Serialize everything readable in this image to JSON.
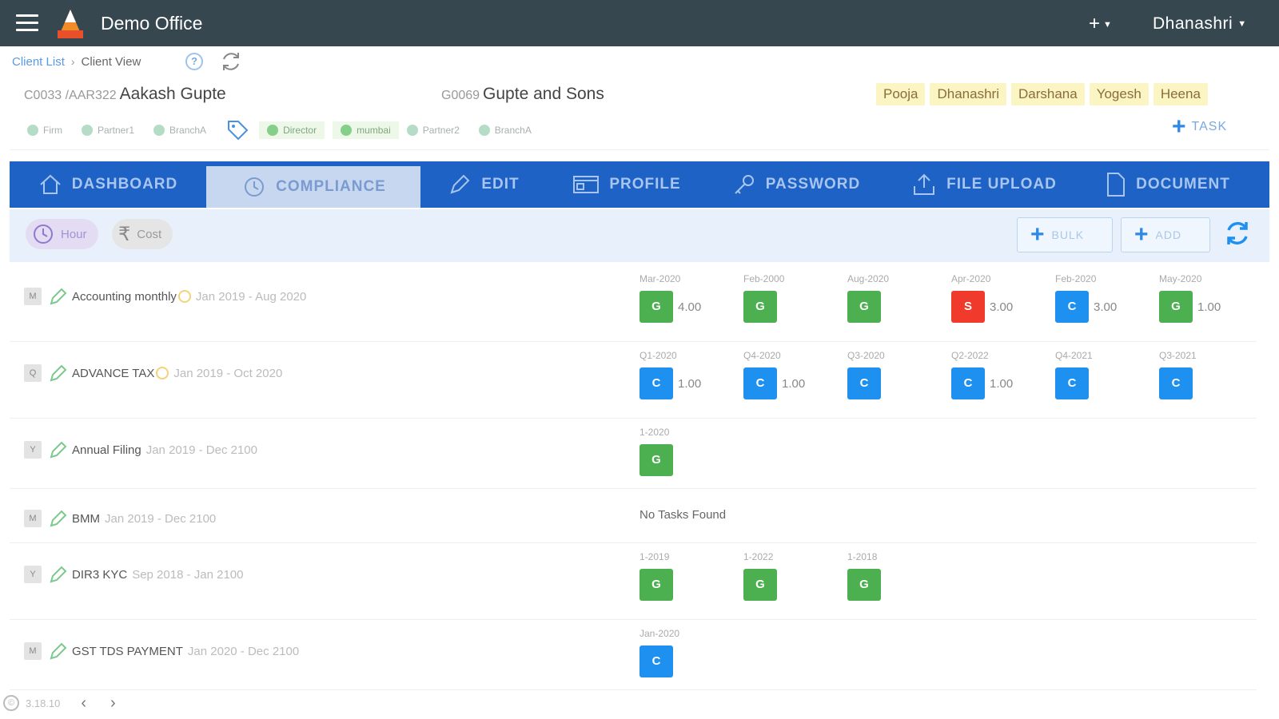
{
  "header": {
    "app_title": "Demo Office",
    "plus_label": "+",
    "user_name": "Dhanashri"
  },
  "breadcrumb": {
    "link": "Client List",
    "current": "Client View",
    "help": "?"
  },
  "client": {
    "code1": "C0033 /AAR322",
    "name1": "Aakash Gupte",
    "code2": "G0069",
    "name2": "Gupte and Sons",
    "assignees": [
      "Pooja",
      "Dhanashri",
      "Darshana",
      "Yogesh",
      "Heena"
    ],
    "tags": {
      "firm": "Firm",
      "partner1": "Partner1",
      "branch_a": "BranchA",
      "director": "Director",
      "mumbai": "mumbai",
      "partner2": "Partner2",
      "branch_a2": "BranchA"
    },
    "task_label": "TASK"
  },
  "tabs": [
    "DASHBOARD",
    "COMPLIANCE",
    "EDIT",
    "PROFILE",
    "PASSWORD",
    "FILE UPLOAD",
    "DOCUMENT"
  ],
  "toolbar": {
    "hour": "Hour",
    "cost": "Cost",
    "bulk": "BULK",
    "add": "ADD"
  },
  "compliances": [
    {
      "freq": "M",
      "name": "Accounting monthly",
      "range": "Jan 2019 - Aug 2020",
      "periods": [
        {
          "label": "Mar-2020",
          "status": "G",
          "hours": "4.00"
        },
        {
          "label": "Feb-2000",
          "status": "G",
          "hours": ""
        },
        {
          "label": "Aug-2020",
          "status": "G",
          "hours": ""
        },
        {
          "label": "Apr-2020",
          "status": "S",
          "hours": "3.00"
        },
        {
          "label": "Feb-2020",
          "status": "C",
          "hours": "3.00"
        },
        {
          "label": "May-2020",
          "status": "G",
          "hours": "1.00"
        }
      ]
    },
    {
      "freq": "Q",
      "name": "ADVANCE TAX",
      "range": "Jan 2019 - Oct 2020",
      "periods": [
        {
          "label": "Q1-2020",
          "status": "C",
          "hours": "1.00"
        },
        {
          "label": "Q4-2020",
          "status": "C",
          "hours": "1.00"
        },
        {
          "label": "Q3-2020",
          "status": "C",
          "hours": ""
        },
        {
          "label": "Q2-2022",
          "status": "C",
          "hours": "1.00"
        },
        {
          "label": "Q4-2021",
          "status": "C",
          "hours": ""
        },
        {
          "label": "Q3-2021",
          "status": "C",
          "hours": ""
        }
      ]
    },
    {
      "freq": "Y",
      "name": "Annual Filing",
      "range": "Jan 2019 - Dec 2100",
      "periods": [
        {
          "label": "1-2020",
          "status": "G",
          "hours": ""
        }
      ]
    },
    {
      "freq": "M",
      "name": "BMM",
      "range": "Jan 2019 - Dec 2100",
      "no_tasks": "No Tasks Found",
      "periods": []
    },
    {
      "freq": "Y",
      "name": "DIR3 KYC",
      "range": "Sep 2018 - Jan 2100",
      "periods": [
        {
          "label": "1-2019",
          "status": "G",
          "hours": ""
        },
        {
          "label": "1-2022",
          "status": "G",
          "hours": ""
        },
        {
          "label": "1-2018",
          "status": "G",
          "hours": ""
        }
      ]
    },
    {
      "freq": "M",
      "name": "GST TDS PAYMENT",
      "range": "Jan 2020 - Dec 2100",
      "periods": [
        {
          "label": "Jan-2020",
          "status": "C",
          "hours": ""
        }
      ]
    }
  ],
  "footer": {
    "version": "3.18.10"
  }
}
